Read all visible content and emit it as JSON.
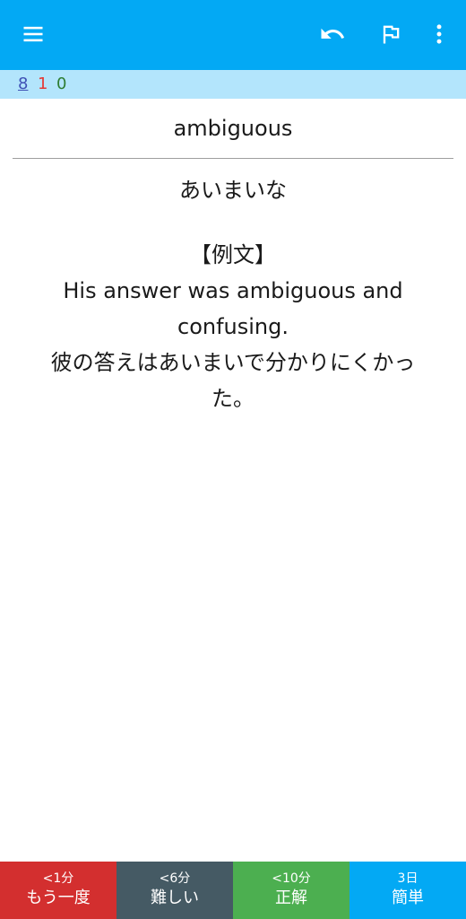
{
  "toolbar": {
    "icons": [
      "menu-icon",
      "undo-icon",
      "flag-icon",
      "more-vert-icon"
    ],
    "color": "#03a9f4"
  },
  "counts": {
    "new": "8",
    "learning": "1",
    "review": "0",
    "colors": {
      "new": "#3f51b5",
      "learning": "#e53935",
      "review": "#2e7d32"
    }
  },
  "card": {
    "front": "ambiguous",
    "meaning": "あいまいな",
    "example_heading": "【例文】",
    "example_en_1": "His answer was ambiguous and",
    "example_en_2": "confusing.",
    "example_ja_1": "彼の答えはあいまいで分かりにくかっ",
    "example_ja_2": "た。"
  },
  "answers": [
    {
      "time": "<1分",
      "label": "もう一度",
      "color": "#d32f2f"
    },
    {
      "time": "<6分",
      "label": "難しい",
      "color": "#455a64"
    },
    {
      "time": "<10分",
      "label": "正解",
      "color": "#4caf50"
    },
    {
      "time": "3日",
      "label": "簡単",
      "color": "#03a9f4"
    }
  ]
}
